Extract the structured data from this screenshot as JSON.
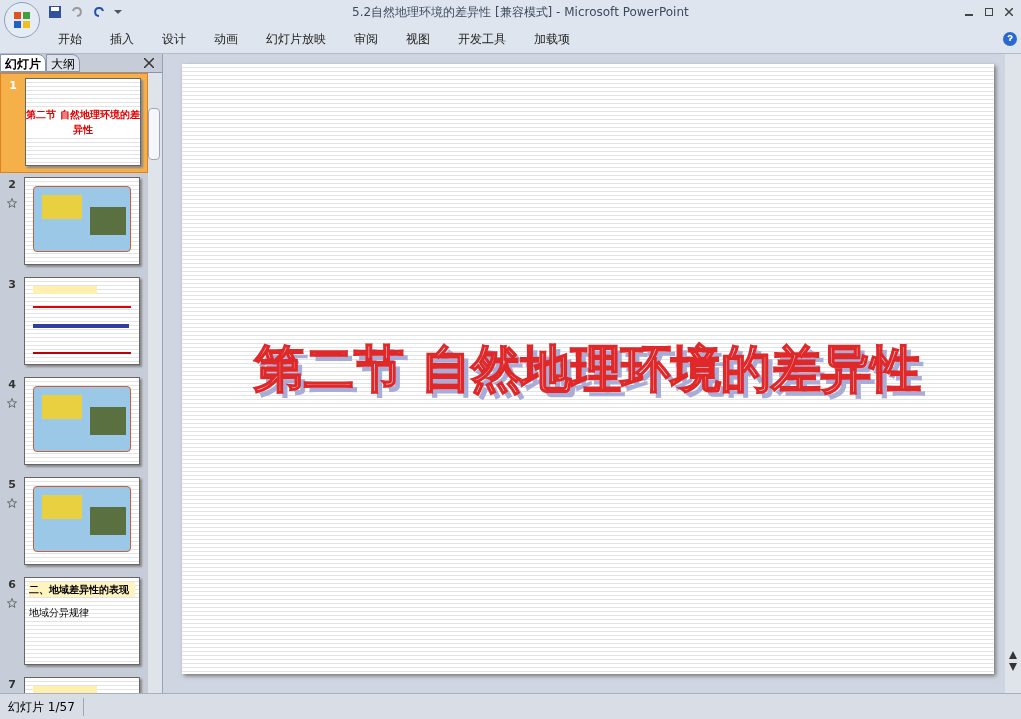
{
  "window": {
    "title": "5.2自然地理环境的差异性 [兼容模式] - Microsoft PowerPoint"
  },
  "ribbon_tabs": [
    {
      "label": "开始",
      "selected": false
    },
    {
      "label": "插入",
      "selected": false
    },
    {
      "label": "设计",
      "selected": false
    },
    {
      "label": "动画",
      "selected": false
    },
    {
      "label": "幻灯片放映",
      "selected": false
    },
    {
      "label": "审阅",
      "selected": false
    },
    {
      "label": "视图",
      "selected": false
    },
    {
      "label": "开发工具",
      "selected": false
    },
    {
      "label": "加载项",
      "selected": false
    }
  ],
  "pane_tabs": [
    {
      "label": "幻灯片",
      "selected": true
    },
    {
      "label": "大纲",
      "selected": false
    }
  ],
  "slides": [
    {
      "number": "1",
      "selected": true,
      "animated": false,
      "kind": "title",
      "title": "第二节 自然地理环境的差异性"
    },
    {
      "number": "2",
      "selected": false,
      "animated": true,
      "kind": "map"
    },
    {
      "number": "3",
      "selected": false,
      "animated": false,
      "kind": "diagram"
    },
    {
      "number": "4",
      "selected": false,
      "animated": true,
      "kind": "map"
    },
    {
      "number": "5",
      "selected": false,
      "animated": true,
      "kind": "map"
    },
    {
      "number": "6",
      "selected": false,
      "animated": true,
      "kind": "text",
      "title": "二、地域差异性的表现",
      "subtitle": "地域分异规律"
    },
    {
      "number": "7",
      "selected": false,
      "animated": false,
      "kind": "diagram"
    }
  ],
  "slide": {
    "title": "第二节 自然地理环境的差异性"
  },
  "status_bar": {
    "slide_indicator": "幻灯片 1/57"
  }
}
